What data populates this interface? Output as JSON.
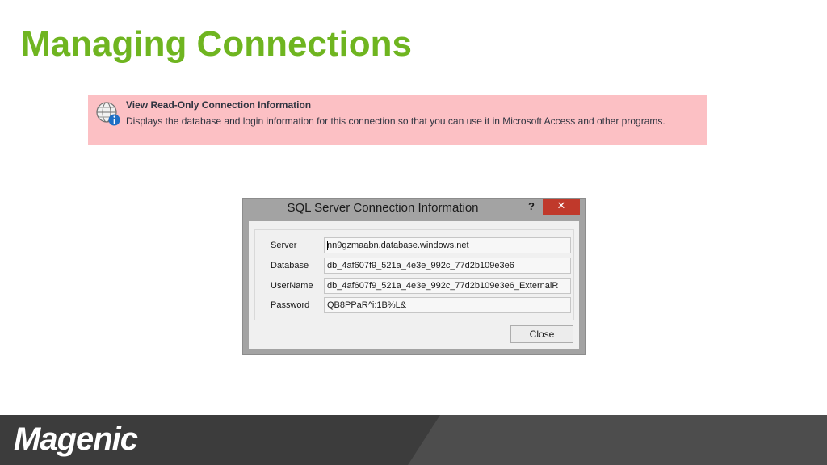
{
  "slide": {
    "title": "Managing Connections",
    "title_color": "#6fb520"
  },
  "banner": {
    "background_color": "#fcc0c4",
    "icon": "globe-info-icon",
    "title": "View Read-Only Connection Information",
    "description": "Displays the database and login information for this connection so that you can use it in Microsoft Access and other programs."
  },
  "dialog": {
    "title": "SQL Server Connection Information",
    "help_label": "?",
    "close_x_label": "✕",
    "close_x_color": "#c0392b",
    "fields": [
      {
        "label": "Server",
        "value": "nn9gzmaabn.database.windows.net"
      },
      {
        "label": "Database",
        "value": "db_4af607f9_521a_4e3e_992c_77d2b109e3e6"
      },
      {
        "label": "UserName",
        "value": "db_4af607f9_521a_4e3e_992c_77d2b109e3e6_ExternalR"
      },
      {
        "label": "Password",
        "value": "QB8PPaR^i:1B%L&"
      }
    ],
    "close_button_label": "Close"
  },
  "footer": {
    "logo": "Magenic"
  }
}
